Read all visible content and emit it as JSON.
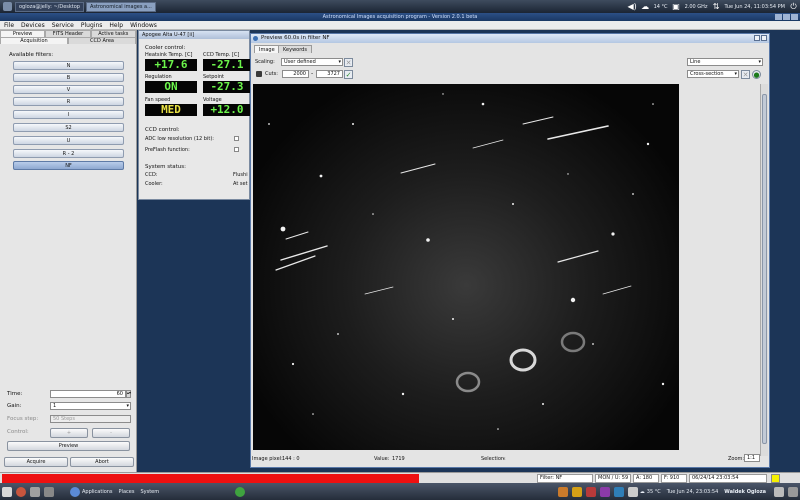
{
  "topbar": {
    "tasks": [
      {
        "label": "ogloza@jelly: ~/Desktop",
        "active": false
      },
      {
        "label": "Astronomical images a...",
        "active": true
      }
    ],
    "temp": "14 °C",
    "cpu": "2.00 GHz",
    "clock": "Tue Jun 24, 11:03:54 PM"
  },
  "window_title": "Astronomical Images acquisition program - Version 2.0.1 beta",
  "menu": [
    "File",
    "Devices",
    "Service",
    "Plugins",
    "Help",
    "Windows"
  ],
  "left_panel": {
    "tabs_top": [
      "Preview",
      "FITS Header",
      "Active tasks"
    ],
    "tabs_bottom": [
      "Acquisition",
      "CCD Area"
    ],
    "filters_label": "Available filters:",
    "filters": [
      "N",
      "B",
      "V",
      "R",
      "I",
      "S2",
      "U",
      "R - 2",
      "NF"
    ],
    "selected_filter": "NF",
    "time_label": "Time:",
    "time_value": "60",
    "gain_label": "Gain:",
    "gain_value": "1",
    "focus_label": "Focus step:",
    "focus_value": "50 Steps",
    "control_label": "Control:",
    "control_plus": "+",
    "control_minus": "-",
    "preview_button": "Preview",
    "acquire_button": "Acquire",
    "abort_button": "Abort"
  },
  "ccd_window": {
    "title": "Apogee Alta U-47 [ii]",
    "cooler_label": "Cooler control:",
    "heatsink_label": "Heatsink Temp. [C]",
    "heatsink_value": "+17.6",
    "ccd_temp_label": "CCD Temp. [C]",
    "ccd_temp_value": "-27.1",
    "regulation_label": "Regulation",
    "regulation_value": "ON",
    "setpoint_label": "Setpoint",
    "setpoint_value": "-27.3",
    "fan_label": "Fan speed",
    "fan_value": "MED",
    "voltage_label": "Voltage",
    "voltage_value": "+12.0",
    "ccd_control_label": "CCD control:",
    "adc_label": "ADC low resolution (12 bit):",
    "preflash_label": "PreFlash function:",
    "system_status_label": "System status:",
    "ccd_label": "CCD:",
    "ccd_status": "Flushi",
    "cooler_status_label": "Cooler:",
    "cooler_status": "At set"
  },
  "preview_window": {
    "title": "Preview 60.0s in filter NF",
    "tabs": [
      "Image",
      "Keywords"
    ],
    "scaling_label": "Scaling:",
    "scaling_value": "User defined",
    "cuts_label": "Cuts:",
    "cut_low": "2000",
    "cut_high": "3727",
    "line_select": "Line",
    "cross_select": "Cross-section",
    "image_pixel_label": "Image pixel:",
    "image_pixel_value": "144 : 0",
    "value_label": "Value:",
    "value_value": "1719",
    "selection_label": "Selection:",
    "selection_value": "-",
    "zoom_label": "Zoom:",
    "zoom_value": "1:1"
  },
  "bottom_status": {
    "filter": "Filter: NF",
    "mount": "MON / U: 59",
    "a": "A: 180",
    "f": "F: 910",
    "datetime": "06/24/14 23:03:54"
  },
  "panel": {
    "applications": "Applications",
    "places": "Places",
    "system": "System",
    "temp": "35 °C",
    "clock": "Tue Jun 24, 23:03:54",
    "user": "Waldek Ogloza"
  },
  "colors": {
    "progress_red": "#ee1010",
    "lcd_green": "#6cf54b",
    "lcd_yellow": "#e8e042",
    "desktop_blue": "#1c3557"
  }
}
